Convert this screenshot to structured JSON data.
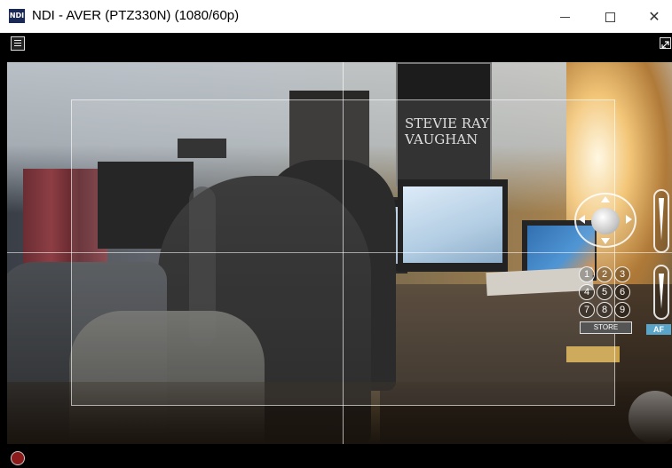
{
  "window": {
    "title": "NDI - AVER (PTZ330N) (1080/60p)",
    "app_icon_text": "NDI",
    "controls": {
      "minimize_glyph": "—",
      "close_glyph": "✕"
    }
  },
  "video": {
    "poster_text": "STEVIE RAY\nVAUGHAN"
  },
  "ptz": {
    "presets": [
      "1",
      "2",
      "3",
      "4",
      "5",
      "6",
      "7",
      "8",
      "9"
    ],
    "store_label": "STORE",
    "af_label": "AF"
  },
  "colors": {
    "record": "#8b1a1a",
    "af_button": "#5aa4c8"
  },
  "icons": [
    "menu-icon",
    "expand-icon",
    "joystick",
    "zoom-slider",
    "focus-slider",
    "record-icon"
  ]
}
